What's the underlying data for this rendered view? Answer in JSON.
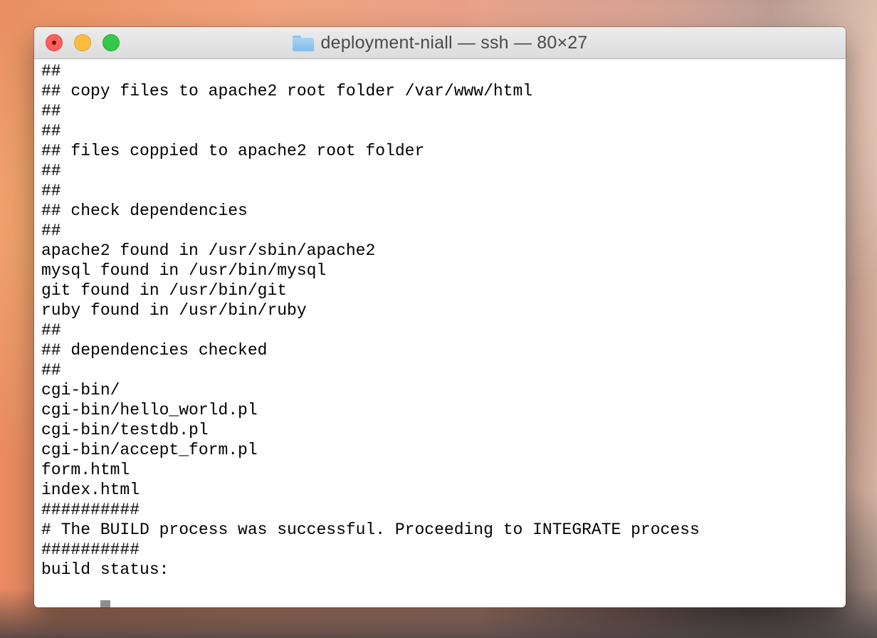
{
  "window": {
    "title": "deployment-niall — ssh — 80×27",
    "title_icon": "folder-icon"
  },
  "terminal": {
    "lines": [
      "##",
      "## copy files to apache2 root folder /var/www/html",
      "##",
      "##",
      "## files coppied to apache2 root folder",
      "##",
      "##",
      "## check dependencies",
      "##",
      "apache2 found in /usr/sbin/apache2",
      "mysql found in /usr/bin/mysql",
      "git found in /usr/bin/git",
      "ruby found in /usr/bin/ruby",
      "##",
      "## dependencies checked",
      "##",
      "cgi-bin/",
      "cgi-bin/hello_world.pl",
      "cgi-bin/testdb.pl",
      "cgi-bin/accept_form.pl",
      "form.html",
      "index.html",
      "##########",
      "# The BUILD process was successful. Proceeding to INTEGRATE process",
      "##########",
      "build status:",
      ""
    ]
  },
  "colors": {
    "close": "#fc605c",
    "minimize": "#fdbc40",
    "zoom": "#34c84a",
    "cursor": "#8e8e8e",
    "terminal_bg": "#ffffff",
    "terminal_text": "#000000"
  }
}
